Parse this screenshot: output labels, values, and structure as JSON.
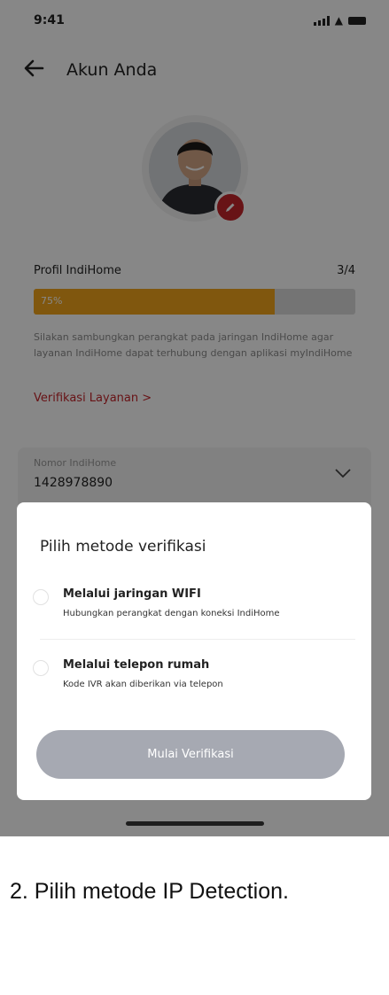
{
  "status_bar": {
    "time": "9:41"
  },
  "header": {
    "title": "Akun Anda",
    "back_icon": "arrow-left-icon"
  },
  "profile": {
    "label": "Profil IndiHome",
    "count": "3/4",
    "progress_text": "75%",
    "progress_value": 0.75,
    "description": "Silakan sambungkan perangkat pada jaringan IndiHome agar layanan IndiHome dapat terhubung dengan aplikasi myIndiHome",
    "verify_link": "Verifikasi Layanan >"
  },
  "nomor": {
    "label": "Nomor IndiHome",
    "value": "1428978890"
  },
  "sheet": {
    "title": "Pilih metode verifikasi",
    "options": [
      {
        "title": "Melalui jaringan WIFI",
        "subtitle": "Hubungkan perangkat dengan koneksi IndiHome"
      },
      {
        "title": "Melalui telepon rumah",
        "subtitle": "Kode IVR akan diberikan via telepon"
      }
    ],
    "cta_label": "Mulai Verifikasi"
  },
  "caption": "2. Pilih metode IP Detection.",
  "colors": {
    "accent_red": "#c4242b",
    "progress_orange": "#f2a51b",
    "button_disabled": "#a6a9b2"
  }
}
